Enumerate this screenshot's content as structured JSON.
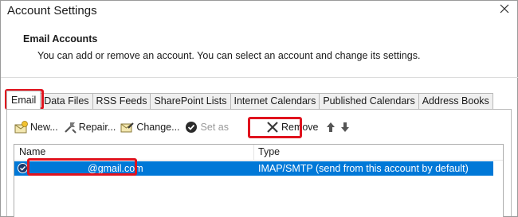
{
  "window": {
    "title": "Account Settings"
  },
  "header": {
    "title": "Email Accounts",
    "description": "You can add or remove an account. You can select an account and change its settings."
  },
  "tabs": [
    {
      "label": "Email",
      "active": true
    },
    {
      "label": "Data Files"
    },
    {
      "label": "RSS Feeds"
    },
    {
      "label": "SharePoint Lists"
    },
    {
      "label": "Internet Calendars"
    },
    {
      "label": "Published Calendars"
    },
    {
      "label": "Address Books"
    }
  ],
  "toolbar": {
    "new_label": "New...",
    "repair_label": "Repair...",
    "change_label": "Change...",
    "set_as_label": "Set as",
    "remove_label": "Remove"
  },
  "accounts_table": {
    "columns": [
      "Name",
      "Type"
    ],
    "rows": [
      {
        "name": "@gmail.com",
        "type": "IMAP/SMTP (send from this account by default)",
        "selected": true
      }
    ]
  },
  "colors": {
    "highlight": "#e0131e",
    "selection": "#0078d7"
  }
}
